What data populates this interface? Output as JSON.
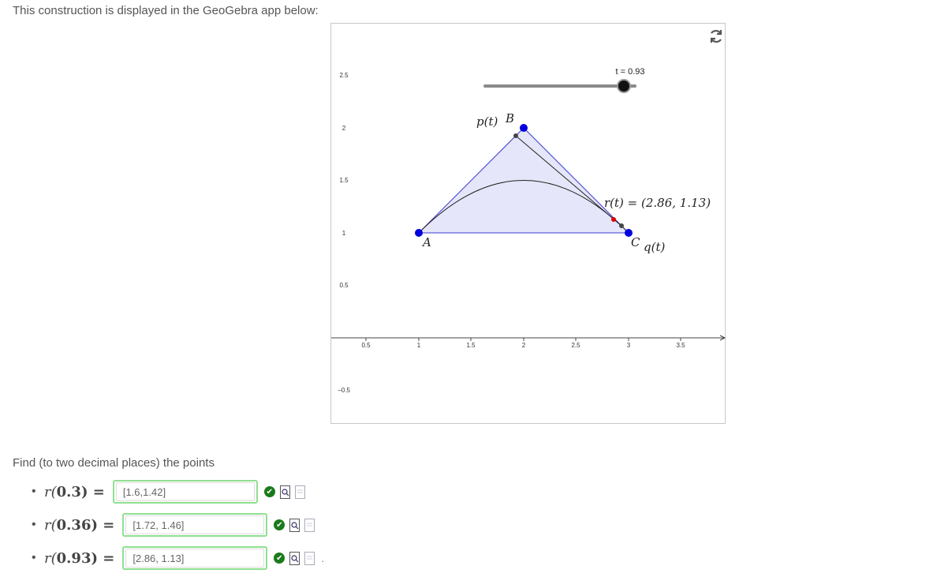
{
  "intro": "This construction is displayed in the GeoGebra app below:",
  "applet": {
    "slider_label": "t = 0.93",
    "slider_value": 0.93,
    "y_ticks": [
      "2.5",
      "2",
      "1.5",
      "1",
      "0.5",
      "−0.5"
    ],
    "x_ticks": [
      "0.5",
      "1",
      "1.5",
      "2",
      "2.5",
      "3",
      "3.5"
    ],
    "label_A": "A",
    "label_B": "B",
    "label_C": "C",
    "label_p": "p(t)",
    "label_q": "q(t)",
    "label_r": "r(t) = (2.86, 1.13)",
    "icon": "refresh-icon"
  },
  "question": {
    "prompt": "Find (to two decimal places) the points",
    "items": [
      {
        "lhs_pre": "r(",
        "arg": "0.3",
        "lhs_post": ") =",
        "value": "[1.6,1.42]"
      },
      {
        "lhs_pre": "r(",
        "arg": "0.36",
        "lhs_post": ") =",
        "value": "[1.72, 1.46]"
      },
      {
        "lhs_pre": "r(",
        "arg": "0.93",
        "lhs_post": ") =",
        "value": "[2.86, 1.13]"
      }
    ],
    "trailing_period": "."
  },
  "colors": {
    "triangle_fill": "#e6e6fa",
    "triangle_stroke": "#3b3bd6",
    "point": "#0000dd",
    "correct": "#8fe08f"
  }
}
